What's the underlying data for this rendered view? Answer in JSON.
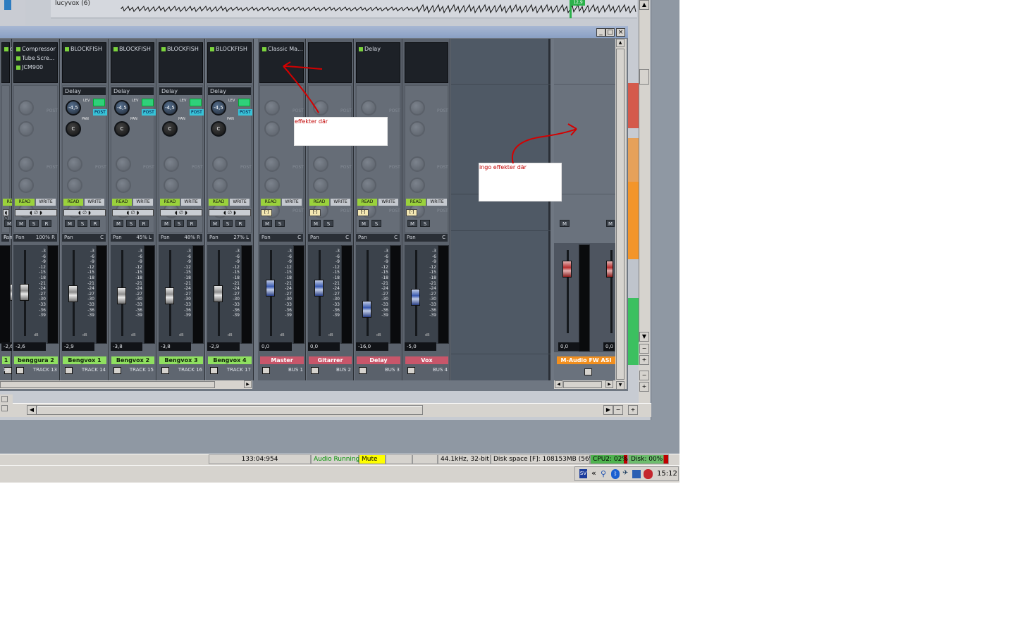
{
  "background_window": {
    "track_label": "lucyvox (6)",
    "marker_value": "12,9"
  },
  "console": {
    "window_buttons": [
      "_",
      "□",
      "×"
    ],
    "strips": [
      {
        "name": "1",
        "sub": "12",
        "name_color": "#8fe060",
        "value": "-2,6",
        "pan": "R",
        "fx": [
          "or",
          "",
          ""
        ],
        "send": "",
        "fader": 0.56
      },
      {
        "name": "benggura 2",
        "sub": "TRACK 13",
        "name_color": "#8fe060",
        "value": "-2,6",
        "pan": "100% R",
        "fx": [
          "Compressor",
          "Tube Scre...",
          "JCM900"
        ],
        "send": "",
        "fader": 0.56
      },
      {
        "name": "Bengvox 1",
        "sub": "TRACK 14",
        "name_color": "#8fe060",
        "value": "-2,9",
        "pan": "C",
        "fx": [
          "BLOCKFISH"
        ],
        "send": "Delay",
        "fader": 0.55
      },
      {
        "name": "Bengvox 2",
        "sub": "TRACK 15",
        "name_color": "#8fe060",
        "value": "-3,8",
        "pan": "45% L",
        "fx": [
          "BLOCKFISH"
        ],
        "send": "Delay",
        "fader": 0.52
      },
      {
        "name": "Bengvox 3",
        "sub": "TRACK 16",
        "name_color": "#8fe060",
        "value": "-3,8",
        "pan": "48% R",
        "fx": [
          "BLOCKFISH"
        ],
        "send": "Delay",
        "fader": 0.52
      },
      {
        "name": "Bengvox 4",
        "sub": "TRACK 17",
        "name_color": "#8fe060",
        "value": "-2,9",
        "pan": "27% L",
        "fx": [
          "BLOCKFISH"
        ],
        "send": "Delay",
        "fader": 0.55
      },
      {
        "name": "Master",
        "sub": "BUS 1",
        "name_color": "#c8566a",
        "value": "0,0",
        "pan": "C",
        "fx": [
          "Classic Ma..."
        ],
        "send": "",
        "fader": 0.62
      },
      {
        "name": "Gitarrer",
        "sub": "BUS 2",
        "name_color": "#c8566a",
        "value": "0,0",
        "pan": "C",
        "fx": [],
        "send": "",
        "fader": 0.62
      },
      {
        "name": "Delay",
        "sub": "BUS 3",
        "name_color": "#c8566a",
        "value": "-16,0",
        "pan": "C",
        "fx": [
          "Delay"
        ],
        "send": "",
        "fader": 0.35
      },
      {
        "name": "Vox",
        "sub": "BUS 4",
        "name_color": "#c8566a",
        "value": "-5,0",
        "pan": "C",
        "fx": [],
        "send": "",
        "fader": 0.5
      }
    ],
    "output_strip": {
      "name": "M-Audio FW ASI",
      "value_left": "0,0",
      "value_right": "0,0"
    },
    "labels": {
      "read": "READ",
      "write": "WRITE",
      "post": "POST",
      "lev": "LEV",
      "pan_word": "PAN",
      "pan_label": "Pan",
      "m": "M",
      "s": "S",
      "r": "R",
      "db": "dB",
      "knob_center": "C",
      "knob_level": "-4,5"
    },
    "meter_scale": [
      "-3",
      "-6",
      "-9",
      "-12",
      "-15",
      "-18",
      "-21",
      "-24",
      "-27",
      "-30",
      "-33",
      "-36",
      "-39"
    ],
    "fader_scale": [
      "6",
      "3",
      "0",
      "-3",
      "-6",
      "-9",
      "-12",
      "-15",
      "-18",
      "-21",
      "-24",
      "-27",
      "-30",
      "-33",
      "-36",
      "-39"
    ]
  },
  "annotations": [
    {
      "text": "effekter där",
      "color": "#c00000"
    },
    {
      "text": "ingo effekter där",
      "color": "#c00000"
    }
  ],
  "statusbar": {
    "time": "133:04:954",
    "audio": "Audio Running",
    "mute": "Mute",
    "format": "44.1kHz, 32-bit",
    "disk_space": "Disk space [F]: 108153MB (56%)",
    "cpu": "CPU2: 02%",
    "disk": "Disk: 00%"
  },
  "taskbar": {
    "clock": "15:12",
    "tray_chevron": "«"
  },
  "colors": {
    "read_green": "#9ad23c",
    "cyan_post": "#38c3d8",
    "status_green": "#00a000",
    "mute_yellow": "#ffff00"
  }
}
